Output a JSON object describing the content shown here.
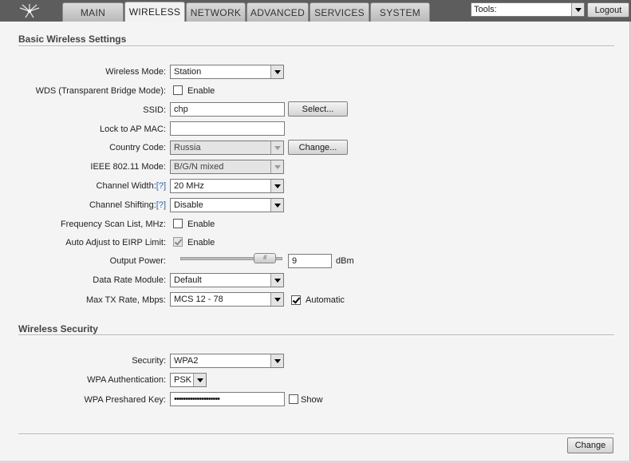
{
  "nav": {
    "logo_icon": "ubiquiti-logo-icon",
    "tabs": [
      {
        "label": "MAIN",
        "active": false
      },
      {
        "label": "WIRELESS",
        "active": true
      },
      {
        "label": "NETWORK",
        "active": false
      },
      {
        "label": "ADVANCED",
        "active": false
      },
      {
        "label": "SERVICES",
        "active": false
      },
      {
        "label": "SYSTEM",
        "active": false
      }
    ],
    "tools_label": "Tools:",
    "logout_label": "Logout"
  },
  "basic": {
    "title": "Basic Wireless Settings",
    "wireless_mode": {
      "label": "Wireless Mode:",
      "value": "Station"
    },
    "wds": {
      "label": "WDS (Transparent Bridge Mode):",
      "checkbox_label": "Enable",
      "checked": false
    },
    "ssid": {
      "label": "SSID:",
      "value": "chp",
      "button": "Select..."
    },
    "lock_ap": {
      "label": "Lock to AP MAC:",
      "value": ""
    },
    "country": {
      "label": "Country Code:",
      "value": "Russia",
      "button": "Change..."
    },
    "ieee_mode": {
      "label": "IEEE 802.11 Mode:",
      "value": "B/G/N mixed"
    },
    "channel_width": {
      "label": "Channel Width:",
      "help": "[?]",
      "value": "20 MHz"
    },
    "channel_shifting": {
      "label": "Channel Shifting:",
      "help": "[?]",
      "value": "Disable"
    },
    "freq_scan": {
      "label": "Frequency Scan List, MHz:",
      "checkbox_label": "Enable",
      "checked": false
    },
    "auto_eirp": {
      "label": "Auto Adjust to EIRP Limit:",
      "checkbox_label": "Enable",
      "checked": true
    },
    "output_power": {
      "label": "Output Power:",
      "value": "9",
      "unit": "dBm",
      "slider_fraction": 0.92
    },
    "data_rate": {
      "label": "Data Rate Module:",
      "value": "Default"
    },
    "max_tx": {
      "label": "Max TX Rate, Mbps:",
      "value": "MCS 12 - 78",
      "checkbox_label": "Automatic",
      "checked": true
    }
  },
  "security": {
    "title": "Wireless Security",
    "security": {
      "label": "Security:",
      "value": "WPA2"
    },
    "wpa_auth": {
      "label": "WPA Authentication:",
      "value": "PSK"
    },
    "wpa_key": {
      "label": "WPA Preshared Key:",
      "value": "••••••••••••••••••••",
      "checkbox_label": "Show",
      "checked": false
    }
  },
  "footer": {
    "change_label": "Change"
  }
}
